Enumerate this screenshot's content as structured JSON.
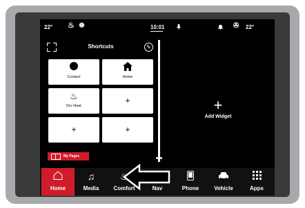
{
  "status_bar": {
    "temp_left": "22°",
    "clock": "10:01",
    "temp_right": "22°",
    "icons": [
      "heated-seat-icon",
      "heated-wheel-icon",
      "microphone-icon",
      "notification-bell-icon",
      "fan-icon"
    ]
  },
  "shortcuts": {
    "title": "Shortcuts",
    "tiles": [
      {
        "label": "Contact",
        "icon": "contact-dot-icon"
      },
      {
        "label": "Home",
        "icon": "home-icon"
      },
      {
        "label": "Drv Heat",
        "icon": "driver-heat-icon"
      },
      {
        "label": "",
        "icon": "plus-icon"
      },
      {
        "label": "",
        "icon": "plus-icon"
      },
      {
        "label": "",
        "icon": "plus-icon"
      }
    ]
  },
  "add_widget": {
    "label": "Add Widget"
  },
  "my_pages": {
    "label": "My Pages"
  },
  "page_indicator": {
    "count": 2
  },
  "nav": {
    "active": "Home",
    "items": [
      {
        "label": "Home",
        "icon": "home-outline-icon"
      },
      {
        "label": "Media",
        "icon": "music-note-icon"
      },
      {
        "label": "Comfort",
        "icon": "seat-comfort-icon"
      },
      {
        "label": "Nav",
        "icon": "navigation-arrow-icon"
      },
      {
        "label": "Phone",
        "icon": "phone-icon"
      },
      {
        "label": "Vehicle",
        "icon": "car-icon"
      },
      {
        "label": "Apps",
        "icon": "apps-grid-icon"
      }
    ]
  },
  "colors": {
    "accent": "#d01c2a",
    "screen": "#000000",
    "bezel": "#a7a9ac"
  }
}
